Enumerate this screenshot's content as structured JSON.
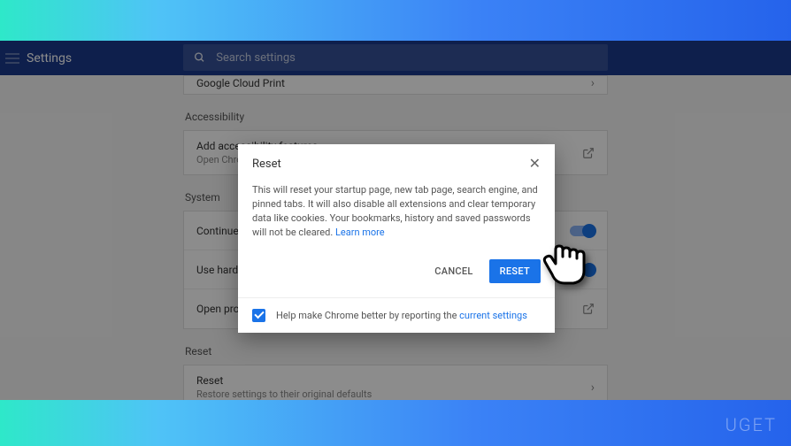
{
  "header": {
    "title": "Settings",
    "search_placeholder": "Search settings"
  },
  "sections": {
    "cloud_print_row": "Google Cloud Print",
    "accessibility": {
      "label": "Accessibility",
      "row_title": "Add accessibility features",
      "row_sub": "Open Chro"
    },
    "system": {
      "label": "System",
      "rows": [
        {
          "title": "Continue r"
        },
        {
          "title": "Use hardw"
        },
        {
          "title": "Open prox"
        }
      ]
    },
    "reset": {
      "label": "Reset",
      "row_title": "Reset",
      "row_sub": "Restore settings to their original defaults"
    }
  },
  "modal": {
    "title": "Reset",
    "body_text": "This will reset your startup page, new tab page, search engine, and pinned tabs. It will also disable all extensions and clear temporary data like cookies. Your bookmarks, history and saved passwords will not be cleared. ",
    "learn_more": "Learn more",
    "cancel": "CANCEL",
    "confirm": "RESET",
    "footer_text": "Help make Chrome better by reporting the ",
    "footer_link": "current settings"
  },
  "watermark": "UGET"
}
